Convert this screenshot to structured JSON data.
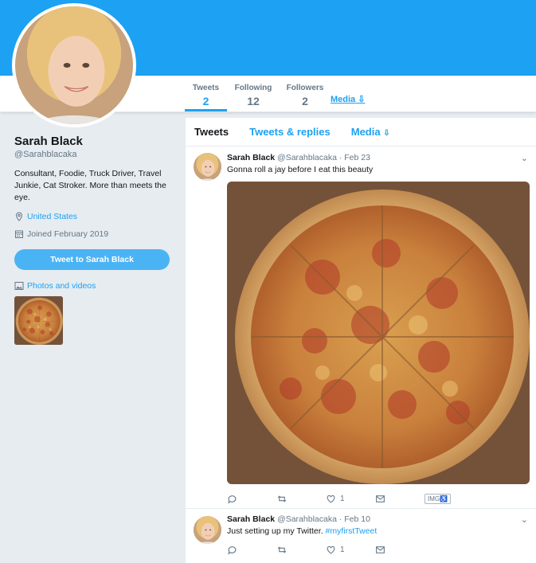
{
  "profile": {
    "name": "Sarah Black",
    "handle": "@Sarahblacaka",
    "bio": "Consultant, Foodie, Truck Driver, Travel Junkie, Cat Stroker. More than meets the eye.",
    "location": "United States",
    "joined": "Joined February 2019",
    "tweet_button": "Tweet to Sarah Black",
    "photos_link": "Photos and videos"
  },
  "stats": {
    "tweets_label": "Tweets",
    "tweets_value": "2",
    "following_label": "Following",
    "following_value": "12",
    "followers_label": "Followers",
    "followers_value": "2",
    "media_label": "Media"
  },
  "tabs": [
    {
      "label": "Tweets"
    },
    {
      "label": "Tweets & replies"
    },
    {
      "label": "Media"
    }
  ],
  "tweets": [
    {
      "name": "Sarah Black",
      "handle": "@Sarahblacaka",
      "date": "· Feb 23",
      "text": "Gonna roll a jay before I eat this beauty",
      "likes": "1",
      "img_tag": "IMG"
    },
    {
      "name": "Sarah Black",
      "handle": "@Sarahblacaka",
      "date": "· Feb 10",
      "text": "Just setting up my Twitter. ",
      "hashtag": "#myfirstTweet",
      "likes": "1"
    }
  ],
  "icons": [
    "location-pin-icon",
    "calendar-icon",
    "photo-icon",
    "reply-icon",
    "retweet-icon",
    "heart-icon",
    "message-icon",
    "chevron-down-icon"
  ],
  "colors": {
    "accent": "#1da1f2",
    "banner": "#1da1f2",
    "background": "#e6ecf0"
  }
}
